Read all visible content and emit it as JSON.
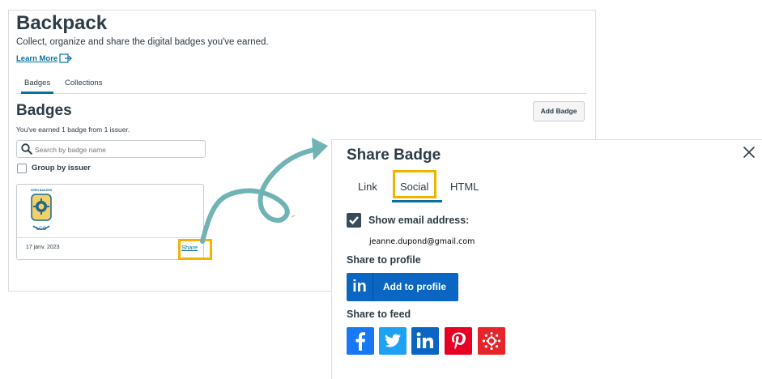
{
  "backpack": {
    "title": "Backpack",
    "subtitle": "Collect, organize and share the digital badges you've earned.",
    "learn_more": "Learn More",
    "tabs": [
      {
        "label": "Badges"
      },
      {
        "label": "Collections"
      }
    ],
    "section_title": "Badges",
    "earned_text": "You've earned 1 badge from 1 issuer.",
    "add_badge": "Add Badge",
    "search": {
      "placeholder": "Search by badge name",
      "value": ""
    },
    "group_by_issuer": "Group by issuer",
    "badge": {
      "image_text": "OPEN BADGES",
      "date": "17 janv. 2023",
      "share": "Share"
    }
  },
  "modal": {
    "title": "Share Badge",
    "tabs": [
      {
        "label": "Link"
      },
      {
        "label": "Social"
      },
      {
        "label": "HTML"
      }
    ],
    "show_email_label": "Show email address:",
    "email": "jeanne.dupond@gmail.com",
    "share_to_profile": "Share to profile",
    "add_to_profile": "Add to profile",
    "share_to_feed": "Share to feed",
    "social_buttons": [
      "facebook-icon",
      "twitter-icon",
      "linkedin-icon",
      "pinterest-icon",
      "canvas-icon"
    ]
  },
  "colors": {
    "link": "#0770a3",
    "highlight": "#f2b400",
    "arrow": "#6fb3b4",
    "linkedin": "#0a66c2",
    "facebook": "#1877f2",
    "twitter": "#1da1f2",
    "pinterest": "#e60023",
    "canvas": "#e72429"
  }
}
